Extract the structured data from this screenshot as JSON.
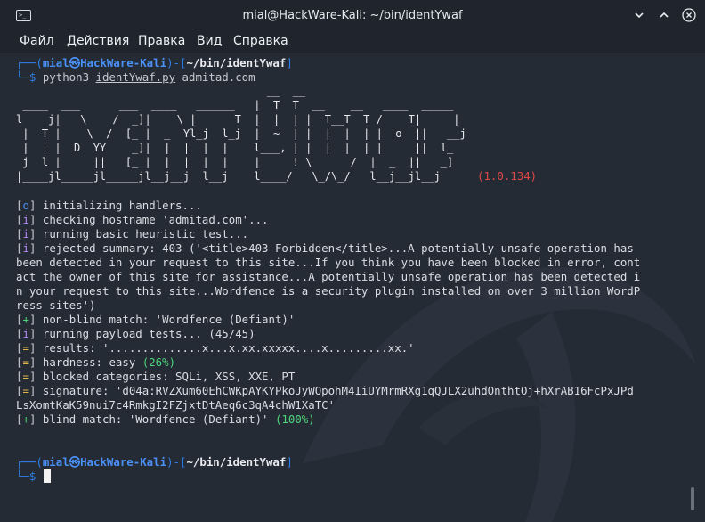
{
  "window": {
    "title": "mial@HackWare-Kali: ~/bin/identYwaf",
    "terminal_icon": "terminal-icon"
  },
  "menu": [
    "Файл",
    "Действия",
    "Правка",
    "Вид",
    "Справка"
  ],
  "prompt1": {
    "top": "┌──(",
    "user": "mial",
    "at": "㉿",
    "host": "HackWare-Kali",
    "mid": ")-[",
    "path": "~/bin/identYwaf",
    "end": "]",
    "bottom": "└─$ ",
    "command": "python3 ",
    "script": "identYwaf.py",
    "arg": " admitad.com"
  },
  "banner": {
    "lines": [
      "                                       __  __",
      " ____  ___      ___  ____   ______   |  T  T  __    __   ____  _____",
      "l    j|   \\    /  _]|    \\ |      T  |  |  | |  T__T  T /    T|     |",
      " |  T |    \\  /  [_ |  _  Yl_j  l_j  |  ~  | |  |  |  | |  o  ||   __j",
      " |  | |  D  YY    _]|  |  |  |  |    l___, | |  |  |  | |     ||  l_",
      " j  l |     ||   [_ |  |  |  |  |    |     ! \\      /  |  _  ||   _]",
      "|____jl_____jl_____jl__j__j  l__j    l____/   \\_/\\_/   l__j__jl__j"
    ],
    "version": "(1.0.134)"
  },
  "output": [
    {
      "tag": "o",
      "text": "initializing handlers..."
    },
    {
      "tag": "i",
      "text": "checking hostname 'admitad.com'..."
    },
    {
      "tag": "i",
      "text": "running basic heuristic test..."
    },
    {
      "tag": "i",
      "text": "rejected summary: 403 ('<title>403 Forbidden</title>...A potentially unsafe operation has"
    },
    {
      "tag": "",
      "text": "been detected in your request to this site...If you think you have been blocked in error, cont"
    },
    {
      "tag": "",
      "text": "act the owner of this site for assistance...A potentially unsafe operation has been detected i"
    },
    {
      "tag": "",
      "text": "n your request to this site...Wordfence is a security plugin installed on over 3 million WordP"
    },
    {
      "tag": "",
      "text": "ress sites')"
    },
    {
      "tag": "+",
      "text": "non-blind match: 'Wordfence (Defiant)'"
    },
    {
      "tag": "i",
      "text": "running payload tests... (45/45)"
    },
    {
      "tag": "=",
      "text": "results: '..............x...x.xx.xxxxx....x.........xx.'"
    },
    {
      "tag": "=",
      "text": "hardness: easy ",
      "extra": "(26%)"
    },
    {
      "tag": "=",
      "text": "blocked categories: SQLi, XSS, XXE, PT"
    },
    {
      "tag": "=",
      "text": "signature: 'd04a:RVZXum60EhCWKpAYKYPkoJyWOpohM4IiUYMrmRXg1qQJLX2uhdOnthtOj+hXrAB16FcPxJPd"
    },
    {
      "tag": "",
      "text": "LsXomtKaK59nui7c4RmkgI2FZjxtDtAeq6c3qA4chW1XaTC'"
    },
    {
      "tag": "+",
      "text": "blind match: 'Wordfence (Defiant)' ",
      "extra": "(100%)"
    }
  ],
  "prompt2": {
    "top": "┌──(",
    "user": "mial",
    "at": "㉿",
    "host": "HackWare-Kali",
    "mid": ")-[",
    "path": "~/bin/identYwaf",
    "end": "]",
    "bottom": "└─$ "
  },
  "colors": {
    "background": "#252b35",
    "prompt_blue": "#2f7fe6",
    "accent_green": "#4fd47b",
    "version_red": "#e04848"
  }
}
